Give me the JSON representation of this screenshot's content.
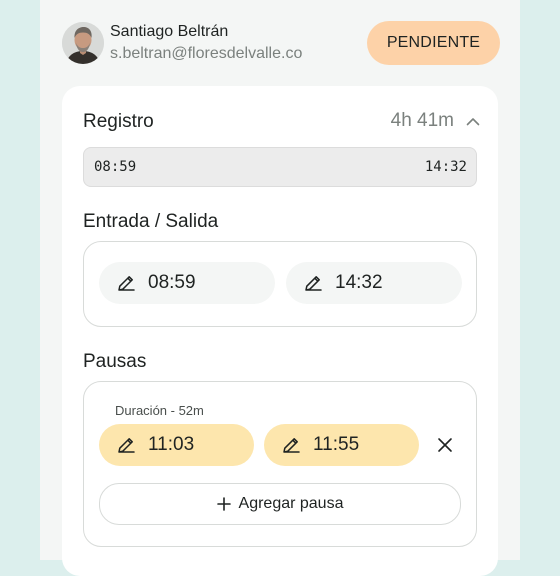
{
  "user": {
    "name": "Santiago Beltrán",
    "email": "s.beltran@floresdelvalle.co",
    "status": "PENDIENTE"
  },
  "registro": {
    "title": "Registro",
    "total": "4h 41m",
    "range_start": "08:59",
    "range_end": "14:32"
  },
  "entrada_salida": {
    "title": "Entrada / Salida",
    "entrada": "08:59",
    "salida": "14:32"
  },
  "pausas": {
    "title": "Pausas",
    "items": [
      {
        "duration_label": "Duración - 52m",
        "start": "11:03",
        "end": "11:55"
      }
    ],
    "add_label": "Agregar pausa"
  },
  "colors": {
    "badge": "#fdd2a8",
    "pause_pill": "#fde6ad",
    "time_pill": "#f4f6f5",
    "background": "#dcefed"
  }
}
